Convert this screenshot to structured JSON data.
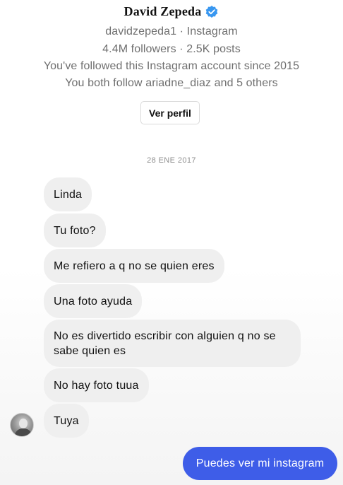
{
  "profile": {
    "name": "David Zepeda",
    "handle_line": "davidzepeda1 · Instagram",
    "stats_line": "4.4M followers · 2.5K posts",
    "followed_since": "You've followed this Instagram account since 2015",
    "mutual_followers": "You both follow ariadne_diaz and 5 others",
    "view_profile_label": "Ver perfil",
    "verified_icon": "verified-badge-icon",
    "verified_color": "#3897f0"
  },
  "conversation": {
    "date_label": "28 ENE 2017",
    "received": [
      {
        "text": "Linda"
      },
      {
        "text": "Tu foto?"
      },
      {
        "text": "Me refiero a q no se quien eres"
      },
      {
        "text": "Una foto ayuda"
      },
      {
        "text": "No es divertido escribir con alguien q no se sabe quien es"
      },
      {
        "text": "No hay foto tuua"
      },
      {
        "text": "Tuya"
      }
    ],
    "sent": [
      {
        "text": "Puedes ver mi instagram"
      }
    ],
    "received_bubble_color": "#efefef",
    "sent_bubble_color": "#3e5de8"
  }
}
